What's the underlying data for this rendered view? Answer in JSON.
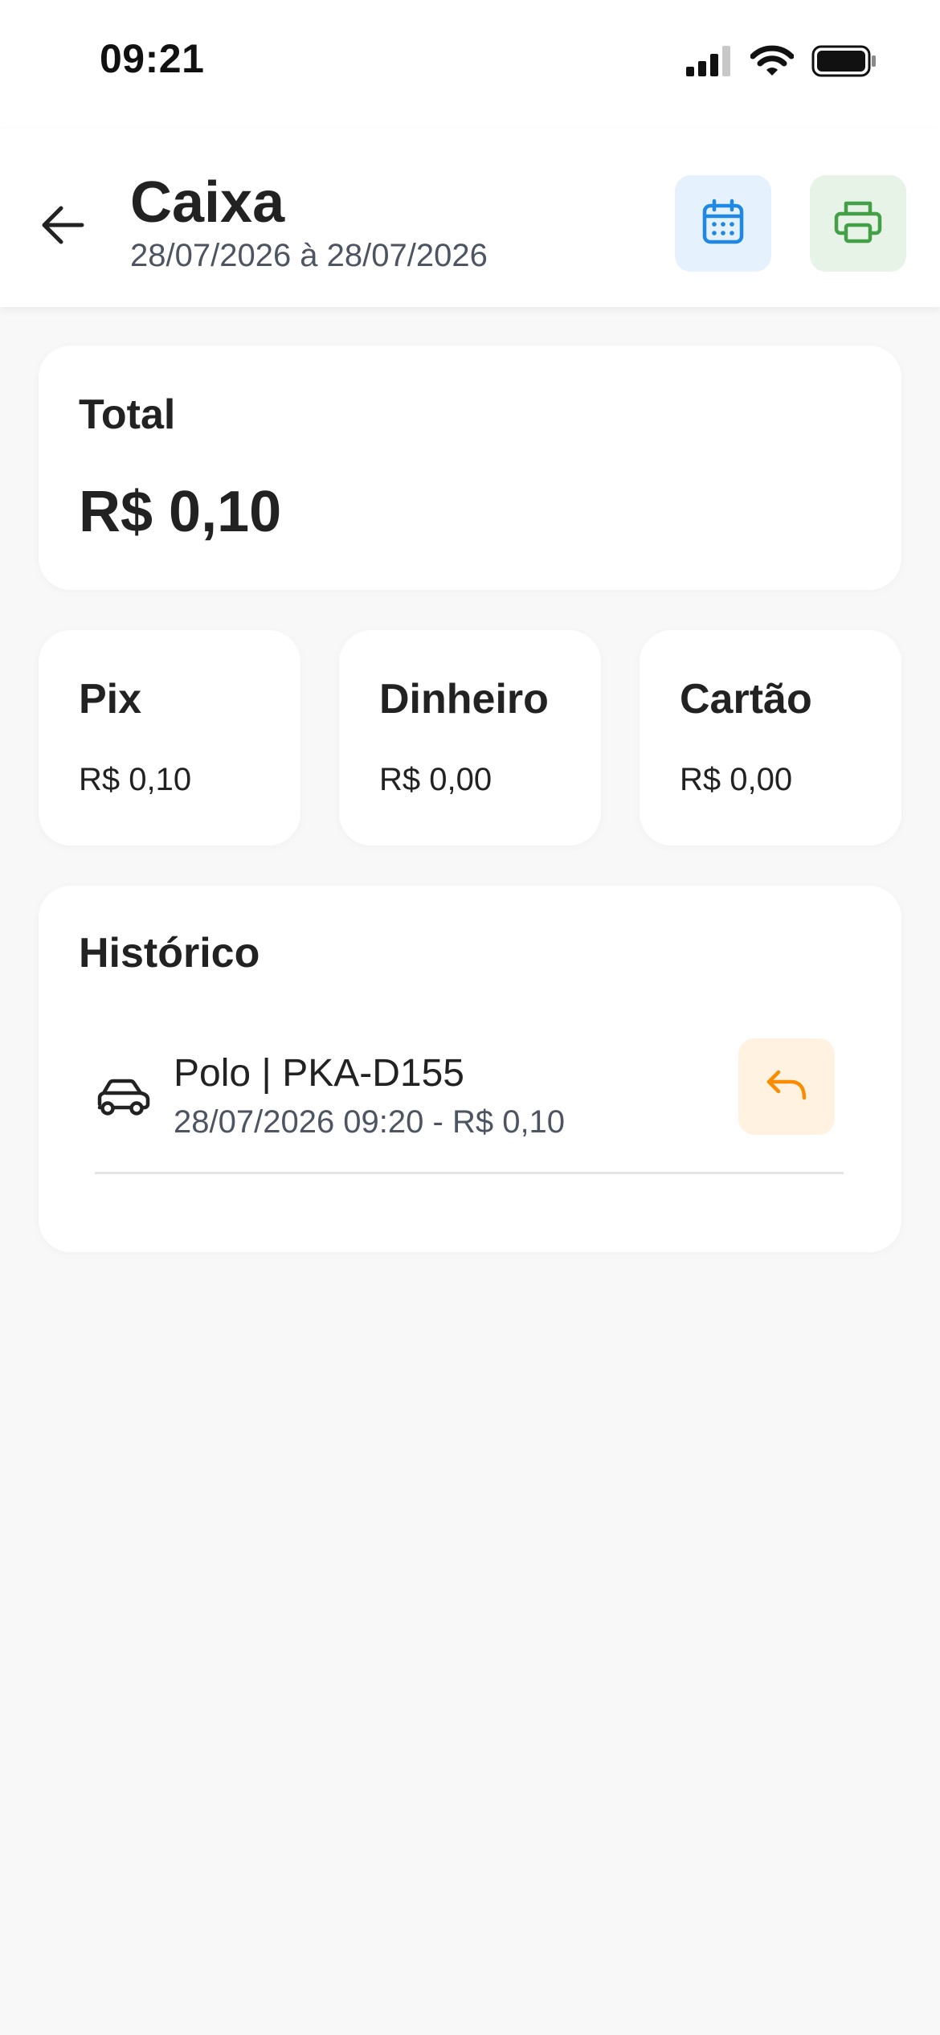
{
  "status_bar": {
    "time": "09:21",
    "icons": [
      "cellular-signal-icon",
      "wifi-icon",
      "battery-icon"
    ]
  },
  "header": {
    "title": "Caixa",
    "subtitle": "28/07/2026 à 28/07/2026",
    "back_icon": "arrow-left-icon",
    "calendar_icon": "calendar-icon",
    "print_icon": "printer-icon"
  },
  "total": {
    "label": "Total",
    "value": "R$ 0,10"
  },
  "payments": [
    {
      "label": "Pix",
      "value": "R$ 0,10"
    },
    {
      "label": "Dinheiro",
      "value": "R$ 0,00"
    },
    {
      "label": "Cartão",
      "value": "R$ 0,00"
    }
  ],
  "history": {
    "title": "Histórico",
    "items": [
      {
        "title": "Polo | PKA-D155",
        "subtitle": "28/07/2026 09:20 - R$ 0,10",
        "icon": "car-icon",
        "action_icon": "undo-icon"
      }
    ]
  },
  "colors": {
    "background": "#f8f8f8",
    "calendar_accent": "#1e88e5",
    "calendar_bg": "#e5f1fc",
    "print_accent": "#43a047",
    "print_bg": "#e6f3e6",
    "undo_accent": "#fb8c00",
    "undo_bg": "#fff2e0"
  }
}
